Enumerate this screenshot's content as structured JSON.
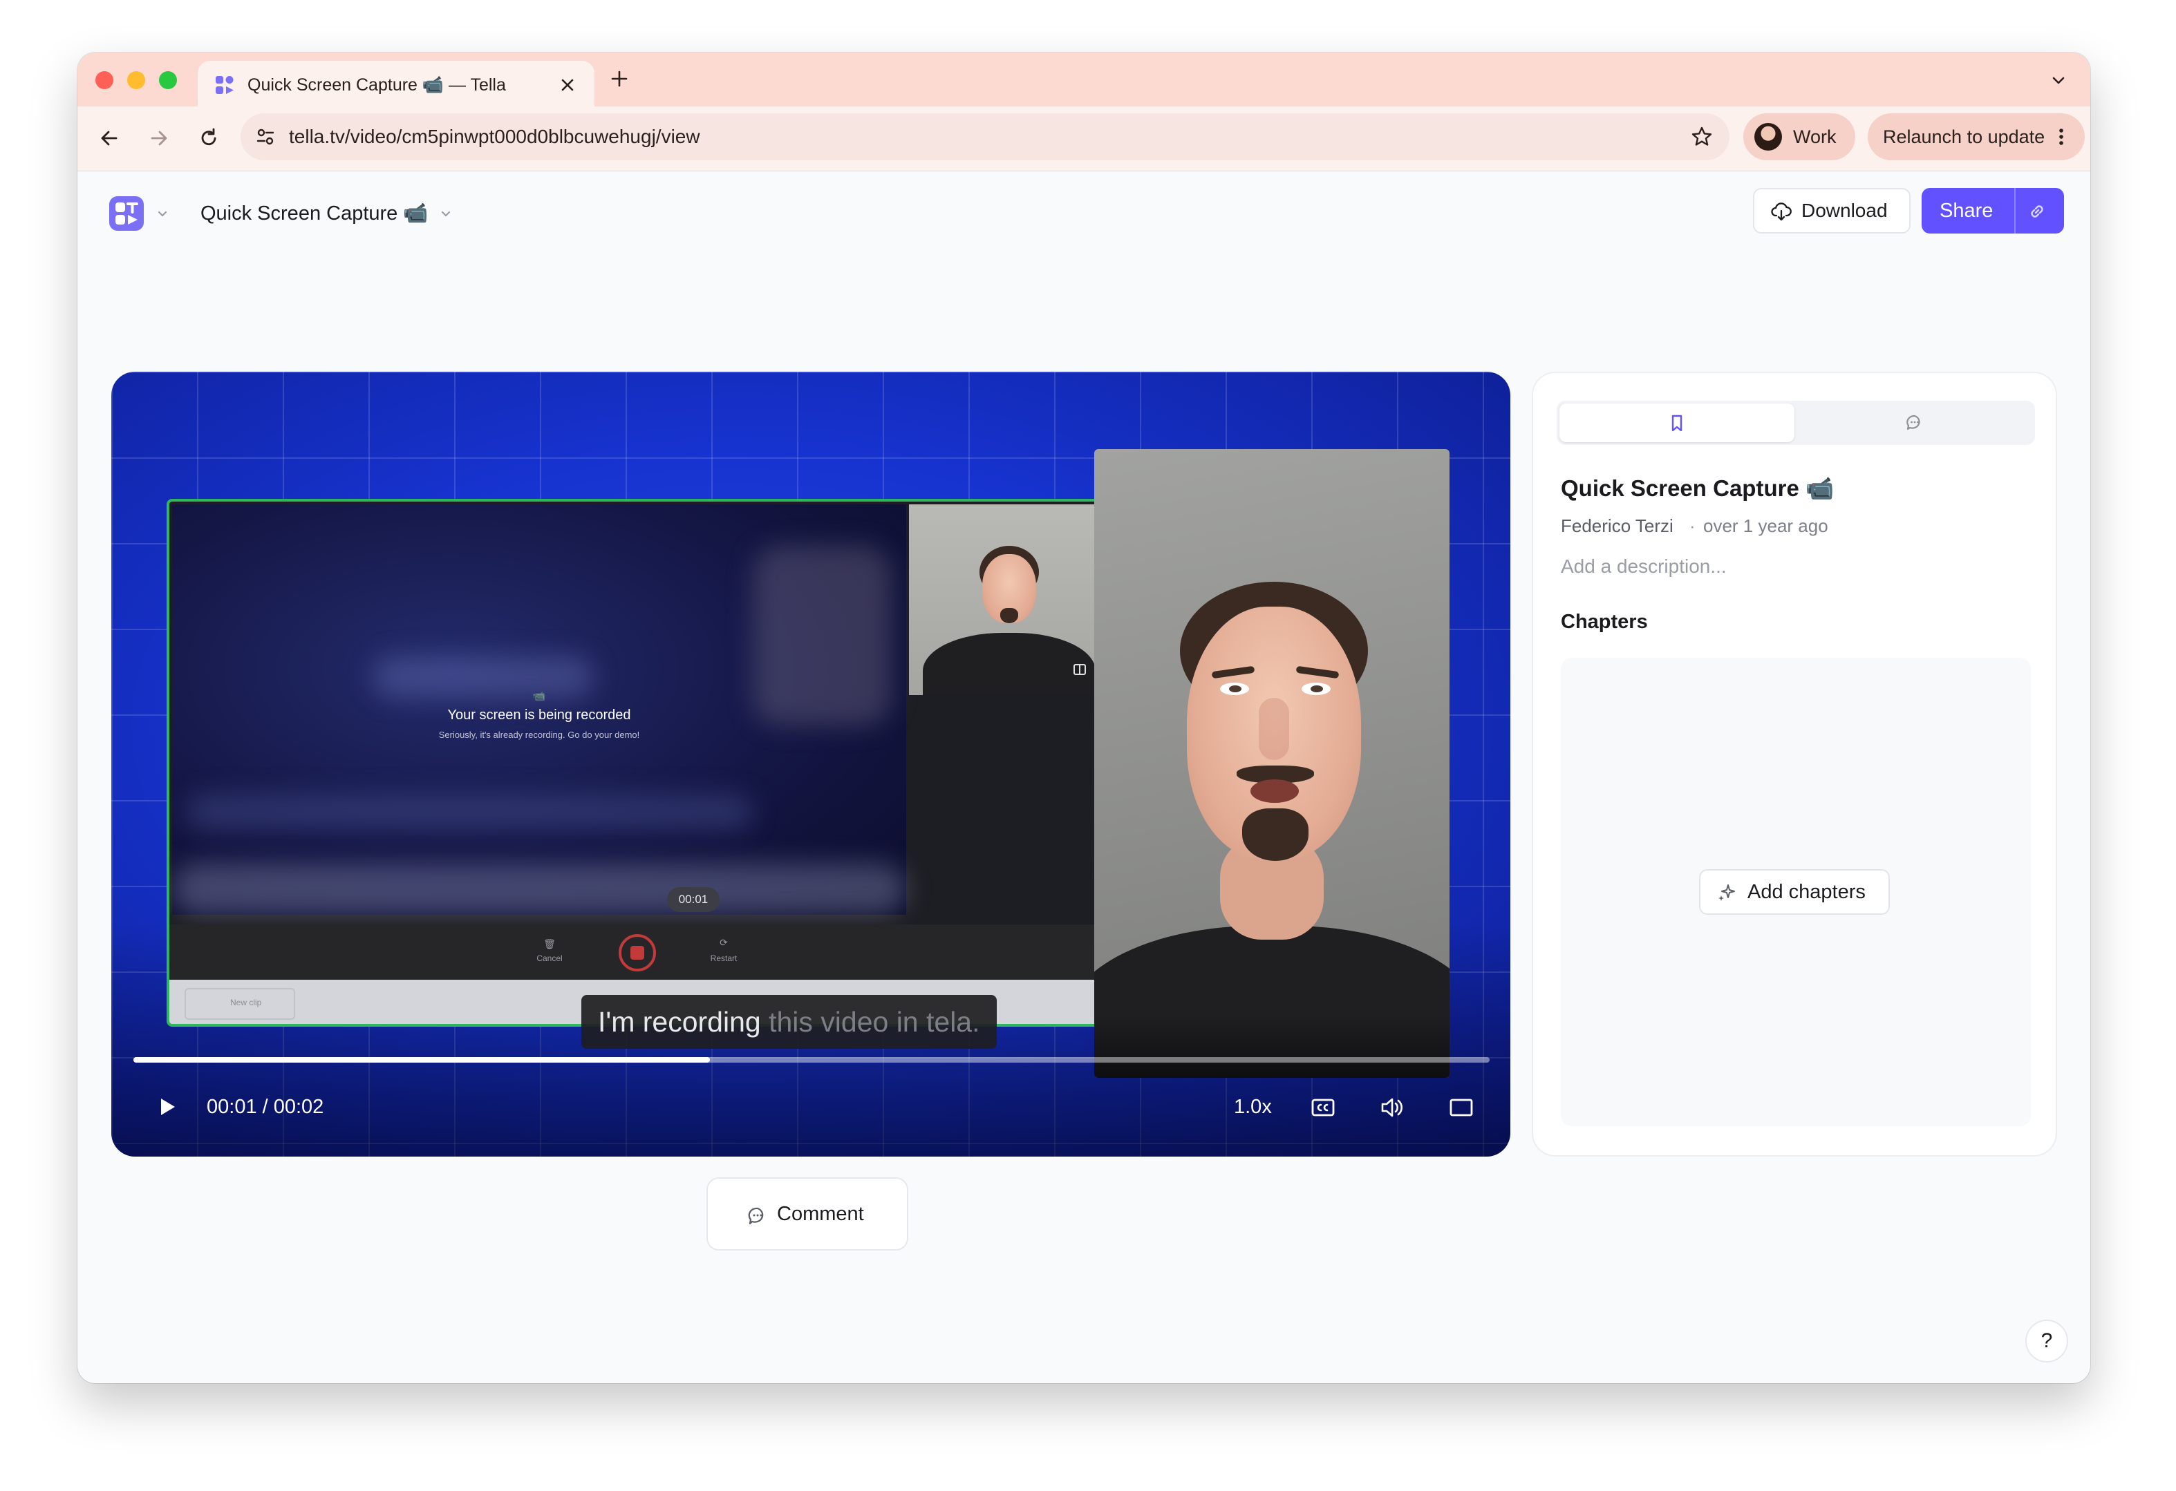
{
  "browser": {
    "tab_title": "Quick Screen Capture 📹 — Tella",
    "url": "tella.tv/video/cm5pinwpt000d0blbcuwehugj/view",
    "profile_label": "Work",
    "relaunch_label": "Relaunch to update"
  },
  "header": {
    "video_title": "Quick Screen Capture 📹",
    "download_label": "Download",
    "share_label": "Share"
  },
  "recording": {
    "overlay_icon": "📹",
    "overlay_title": "Your screen is being recorded",
    "overlay_subtitle": "Seriously, it's already recording. Go do your demo!",
    "timer": "00:01",
    "cancel_label": "Cancel",
    "restart_label": "Restart",
    "new_clip_label": "New clip"
  },
  "player": {
    "caption_spoken": "I'm recording",
    "caption_upcoming": " this video in tela.",
    "time_readout": "00:01 / 00:02",
    "progress_fraction": 0.425,
    "speed_label": "1.0x"
  },
  "comment": {
    "label": "Comment"
  },
  "panel": {
    "title": "Quick Screen Capture 📹",
    "author": "Federico Terzi",
    "separator": "·",
    "time_ago": "over 1 year ago",
    "description_placeholder": "Add a description...",
    "chapters_heading": "Chapters",
    "add_chapters_label": "Add chapters"
  },
  "help": {
    "label": "?"
  },
  "colors": {
    "accent": "#6151ff",
    "tab_bar": "#fcd9d1",
    "player_blue": "#1733cf",
    "recording_border": "#2fb65e"
  }
}
